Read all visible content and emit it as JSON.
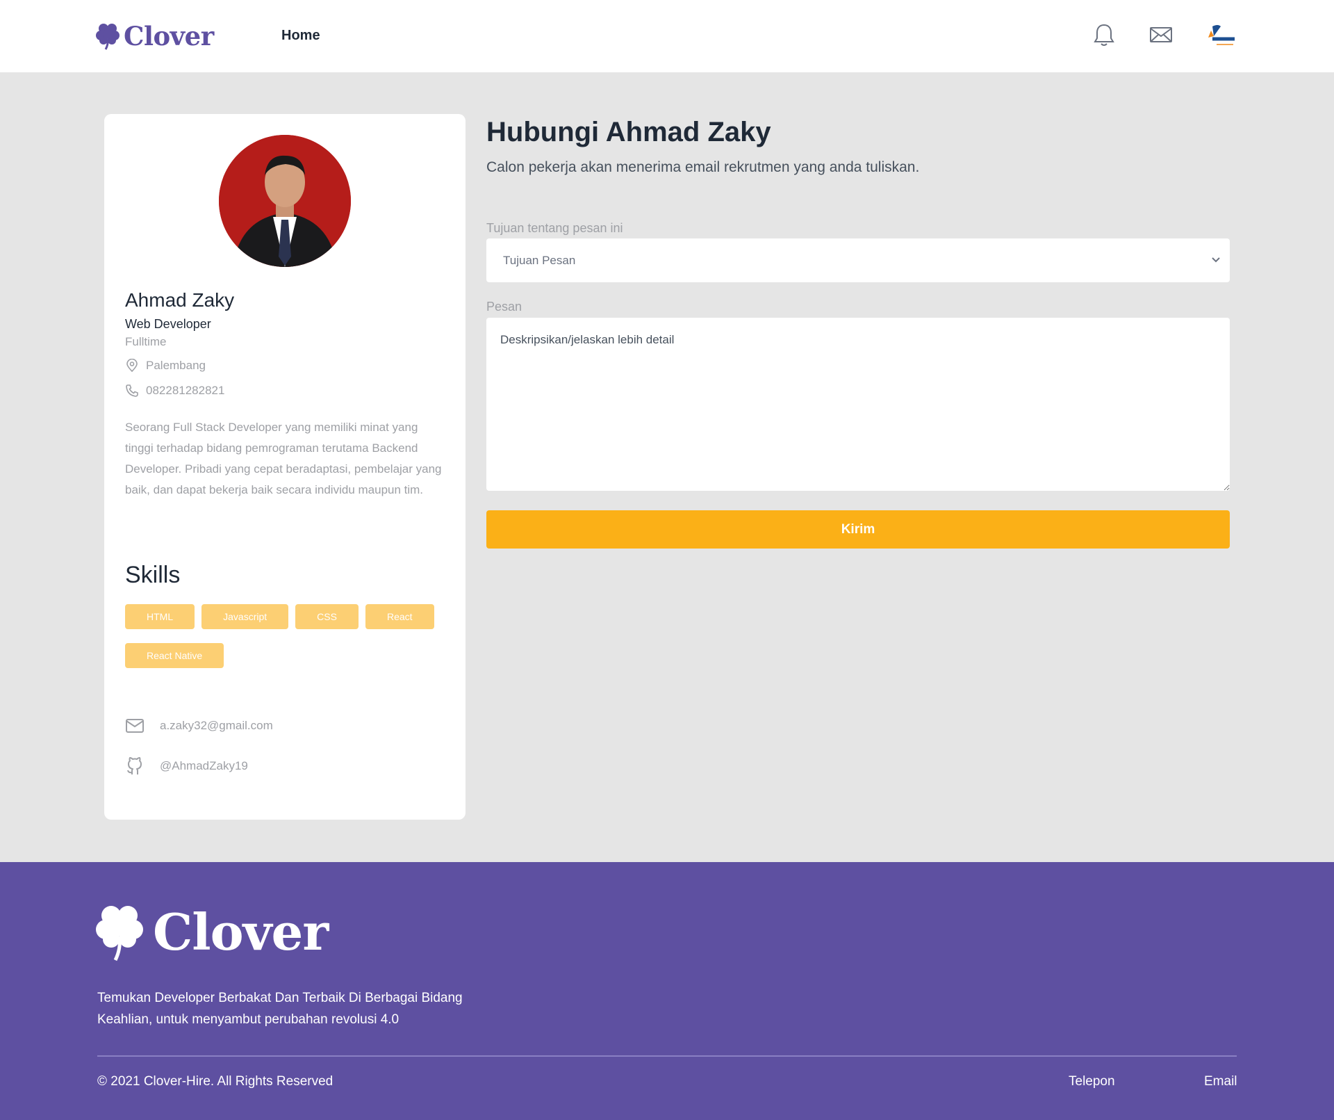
{
  "navbar": {
    "brand": "Clover",
    "home_label": "Home",
    "icons": [
      "bell-icon",
      "mail-icon"
    ]
  },
  "profile": {
    "name": "Ahmad Zaky",
    "job": "Web Developer",
    "type": "Fulltime",
    "location": "Palembang",
    "phone": "082281282821",
    "bio": "Seorang Full Stack Developer yang memiliki minat yang tinggi terhadap bidang pemrograman terutama Backend Developer. Pribadi yang cepat beradaptasi, pembelajar yang baik, dan dapat bekerja baik secara individu maupun tim.",
    "skills_title": "Skills",
    "skills": [
      "HTML",
      "Javascript",
      "CSS",
      "React",
      "React Native"
    ],
    "email": "a.zaky32@gmail.com",
    "github": "@AhmadZaky19"
  },
  "form": {
    "title": "Hubungi Ahmad Zaky",
    "subtitle": "Calon pekerja akan menerima email rekrutmen yang anda tuliskan.",
    "purpose_label": "Tujuan tentang pesan ini",
    "purpose_value": "Tujuan Pesan",
    "message_label": "Pesan",
    "message_placeholder": "Deskripsikan/jelaskan lebih detail",
    "submit_label": "Kirim"
  },
  "footer": {
    "brand": "Clover",
    "tagline": "Temukan Developer Berbakat Dan Terbaik Di Berbagai Bidang Keahlian, untuk menyambut perubahan revolusi 4.0",
    "copyright": "© 2021 Clover-Hire. All Rights Reserved",
    "link_phone": "Telepon",
    "link_email": "Email"
  },
  "colors": {
    "brand_purple": "#5e50a1",
    "accent_yellow": "#fbb017",
    "background": "#e5e5e5"
  }
}
